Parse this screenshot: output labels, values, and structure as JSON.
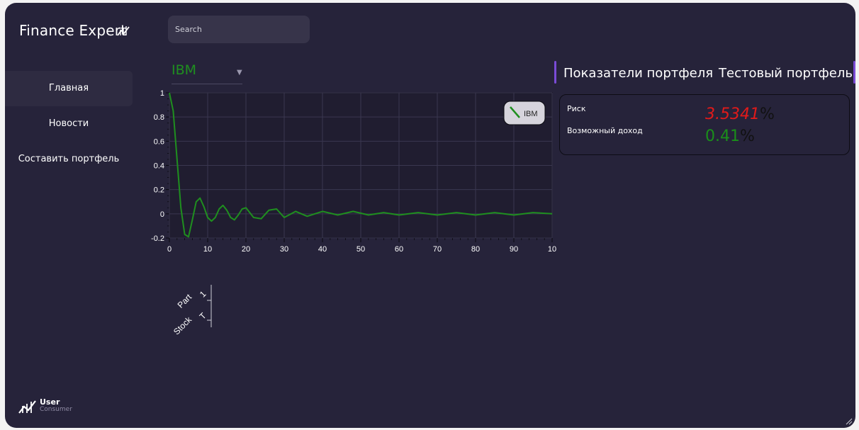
{
  "app": {
    "title": "Finance Expert"
  },
  "search": {
    "placeholder": "Search"
  },
  "nav": {
    "items": [
      {
        "label": "Главная",
        "active": true
      },
      {
        "label": "Новости",
        "active": false
      },
      {
        "label": "Составить портфель",
        "active": false
      }
    ]
  },
  "user": {
    "name": "User",
    "role": "Consumer"
  },
  "ticker": {
    "selected": "IBM"
  },
  "tabs": [
    {
      "label": "Показатели портфеля"
    },
    {
      "label": "Тестовый портфель"
    }
  ],
  "metrics": {
    "risk": {
      "label": "Риск",
      "value": "3.5341",
      "unit": "%",
      "color": "#e11a1a"
    },
    "income": {
      "label": "Возможный доход",
      "value": "0.41",
      "unit": "%",
      "color": "#1a8f1a"
    }
  },
  "stock_table": {
    "headers": [
      "Part",
      "Stock"
    ],
    "values": [
      "1",
      "T"
    ]
  },
  "chart_data": {
    "type": "line",
    "title": "",
    "xlabel": "",
    "ylabel": "",
    "xlim": [
      0,
      100
    ],
    "ylim": [
      -0.2,
      1
    ],
    "x_ticks": [
      "0",
      "10",
      "20",
      "30",
      "40",
      "50",
      "60",
      "70",
      "80",
      "90",
      "10"
    ],
    "y_ticks": [
      "1",
      "0.8",
      "0.6",
      "0.4",
      "0.2",
      "0",
      "-0.2"
    ],
    "legend": "top-right",
    "grid": true,
    "series": [
      {
        "name": "IBM",
        "color": "#1f8f1f",
        "x": [
          0,
          1,
          2,
          3,
          4,
          5,
          6,
          7,
          8,
          9,
          10,
          11,
          12,
          13,
          14,
          15,
          16,
          17,
          18,
          19,
          20,
          22,
          24,
          26,
          28,
          30,
          33,
          36,
          40,
          44,
          48,
          52,
          56,
          60,
          65,
          70,
          75,
          80,
          85,
          90,
          95,
          100
        ],
        "y": [
          1.0,
          0.85,
          0.45,
          0.05,
          -0.17,
          -0.19,
          -0.05,
          0.1,
          0.13,
          0.06,
          -0.03,
          -0.06,
          -0.03,
          0.04,
          0.07,
          0.03,
          -0.03,
          -0.05,
          -0.01,
          0.04,
          0.05,
          -0.03,
          -0.04,
          0.03,
          0.04,
          -0.03,
          0.02,
          -0.02,
          0.02,
          -0.01,
          0.02,
          -0.01,
          0.01,
          -0.01,
          0.01,
          -0.01,
          0.01,
          -0.01,
          0.01,
          -0.01,
          0.01,
          0.0
        ]
      }
    ]
  }
}
